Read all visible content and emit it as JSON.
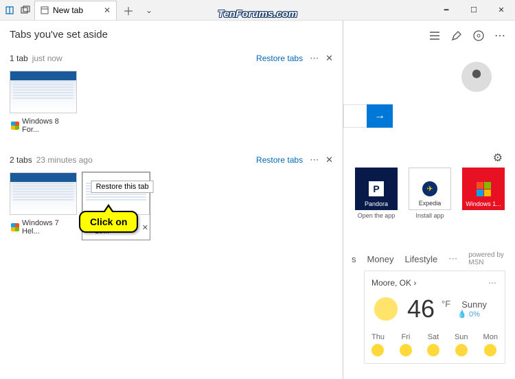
{
  "watermark": "TenForums.com",
  "titlebar": {
    "tab_title": "New tab"
  },
  "aside": {
    "title": "Tabs you've set aside",
    "groups": [
      {
        "count_label": "1 tab",
        "time_label": "just now",
        "restore_label": "Restore tabs",
        "thumbs": [
          {
            "title": "Windows 8 For..."
          }
        ]
      },
      {
        "count_label": "2 tabs",
        "time_label": "23 minutes ago",
        "restore_label": "Restore tabs",
        "thumbs": [
          {
            "title": "Windows 7 Hel..."
          },
          {
            "title": "Windows 10...",
            "tooltip": "Restore this tab",
            "hovered": true
          }
        ]
      }
    ]
  },
  "callout": {
    "text": "Click on"
  },
  "newtab": {
    "tiles": [
      {
        "name": "Pandora",
        "sub": "Open the app",
        "kind": "pandora"
      },
      {
        "name": "Expedia",
        "sub": "Install app",
        "kind": "expedia"
      },
      {
        "name": "Windows 1...",
        "sub": "",
        "kind": "win10"
      }
    ],
    "feed_tabs": [
      "s",
      "Money",
      "Lifestyle"
    ],
    "powered_by": "powered by MSN",
    "weather": {
      "location": "Moore, OK",
      "temp": "46",
      "unit": "°F",
      "condition": "Sunny",
      "precip": "0%",
      "forecast_days": [
        "Thu",
        "Fri",
        "Sat",
        "Sun",
        "Mon"
      ]
    }
  }
}
